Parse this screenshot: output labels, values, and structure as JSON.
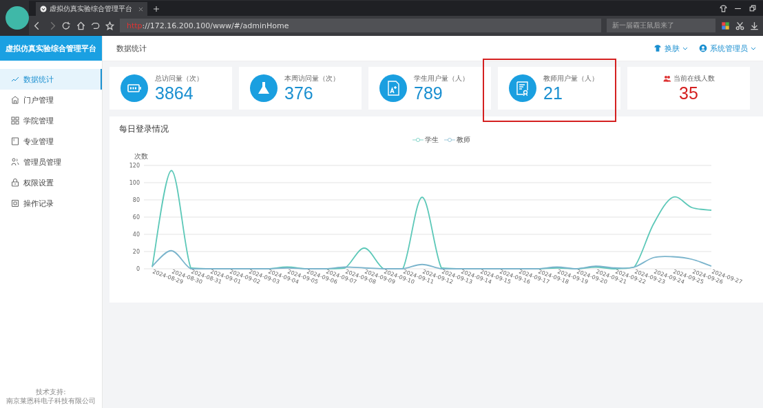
{
  "browser": {
    "tab_title": "虚拟仿真实验综合管理平台",
    "url_scheme": "http",
    "url_rest": "://172.16.200.100/www/#/adminHome",
    "search_placeholder": "新一届霸王鼠后来了"
  },
  "sidebar": {
    "title": "虚拟仿真实验综合管理平台",
    "items": [
      {
        "label": "数据统计",
        "selected": true,
        "kind": "chart"
      },
      {
        "label": "门户管理",
        "selected": false,
        "kind": "home"
      },
      {
        "label": "学院管理",
        "selected": false,
        "kind": "grid"
      },
      {
        "label": "专业管理",
        "selected": false,
        "kind": "book"
      },
      {
        "label": "管理员管理",
        "selected": false,
        "kind": "users"
      },
      {
        "label": "权限设置",
        "selected": false,
        "kind": "lock"
      },
      {
        "label": "操作记录",
        "selected": false,
        "kind": "log"
      }
    ],
    "footer": [
      "技术支持:",
      "南京莱恩科电子科技有限公司"
    ]
  },
  "header": {
    "breadcrumb": "数据统计",
    "skin": "换肤",
    "user": "系统管理员"
  },
  "stats": [
    {
      "label": "总访问量（次）",
      "value": "3864",
      "kind": "battery",
      "highlighted": false
    },
    {
      "label": "本周访问量（次）",
      "value": "376",
      "kind": "flask",
      "highlighted": false
    },
    {
      "label": "学生用户量（人）",
      "value": "789",
      "kind": "doc",
      "highlighted": false
    },
    {
      "label": "教师用户量（人）",
      "value": "21",
      "kind": "cert",
      "highlighted": true
    },
    {
      "label": "当前在线人数",
      "value": "35",
      "kind": "online",
      "highlighted": false
    }
  ],
  "chart": {
    "title": "每日登录情况",
    "chart_data": {
      "type": "line",
      "grid": true,
      "ylabel": "次数",
      "ylim": [
        0,
        120
      ],
      "yticks": [
        0,
        20,
        40,
        60,
        80,
        100,
        120
      ],
      "categories": [
        "2024-08-29",
        "2024-08-30",
        "2024-08-31",
        "2024-09-01",
        "2024-09-02",
        "2024-09-03",
        "2024-09-04",
        "2024-09-05",
        "2024-09-06",
        "2024-09-07",
        "2024-09-08",
        "2024-09-09",
        "2024-09-10",
        "2024-09-11",
        "2024-09-12",
        "2024-09-13",
        "2024-09-14",
        "2024-09-15",
        "2024-09-16",
        "2024-09-17",
        "2024-09-18",
        "2024-09-19",
        "2024-09-20",
        "2024-09-21",
        "2024-09-22",
        "2024-09-23",
        "2024-09-24",
        "2024-09-25",
        "2024-09-26",
        "2024-09-27"
      ],
      "series": [
        {
          "name": "学生",
          "color": "#5cc8b8",
          "values": [
            2,
            114,
            1,
            0,
            0,
            0,
            0,
            2,
            0,
            0,
            1,
            24,
            0,
            0,
            83,
            1,
            0,
            0,
            0,
            0,
            0,
            1,
            0,
            2,
            0,
            2,
            52,
            83,
            71,
            68
          ]
        },
        {
          "name": "教师",
          "color": "#7ab4cc",
          "values": [
            3,
            21,
            0,
            0,
            0,
            0,
            0,
            1,
            0,
            0,
            2,
            1,
            0,
            0,
            5,
            0,
            0,
            0,
            0,
            0,
            0,
            2,
            0,
            3,
            1,
            2,
            13,
            14,
            11,
            3
          ]
        }
      ]
    }
  }
}
